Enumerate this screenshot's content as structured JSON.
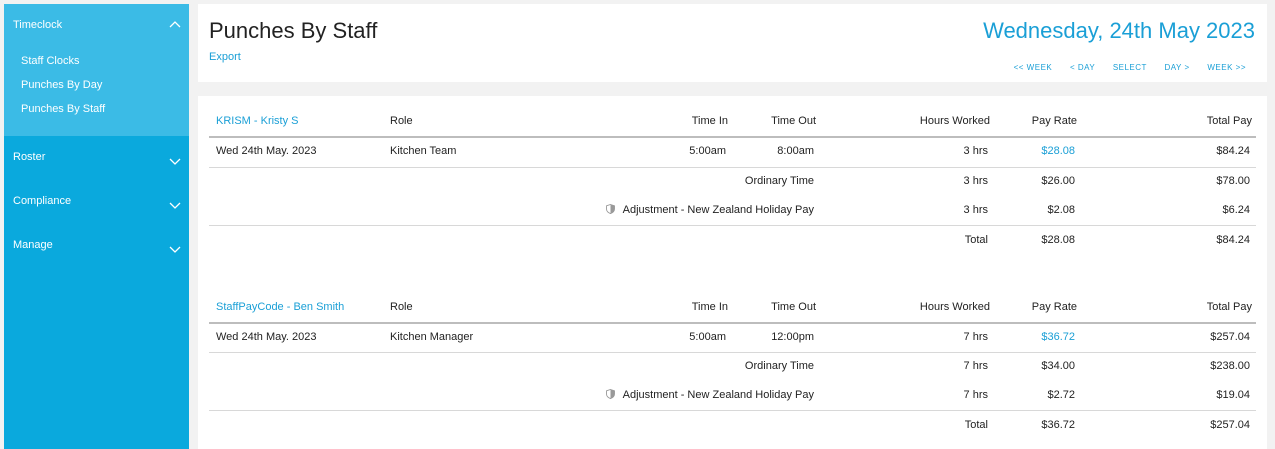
{
  "sidebar": {
    "timeclock": {
      "label": "Timeclock",
      "items": [
        "Staff Clocks",
        "Punches By Day",
        "Punches By Staff"
      ]
    },
    "sections": [
      "Roster",
      "Compliance",
      "Manage"
    ]
  },
  "header": {
    "title": "Punches By Staff",
    "export_label": "Export",
    "date": "Wednesday, 24th May 2023",
    "nav": {
      "prev_week": "<< WEEK",
      "prev_day": "< DAY",
      "select": "SELECT",
      "next_day": "DAY >",
      "next_week": "WEEK >>"
    }
  },
  "columns": {
    "role": "Role",
    "time_in": "Time In",
    "time_out": "Time Out",
    "hours": "Hours Worked",
    "pay_rate": "Pay Rate",
    "total_pay": "Total Pay"
  },
  "groups": [
    {
      "staff": "KRISM - Kristy S",
      "punch": {
        "date": "Wed 24th May. 2023",
        "role": "Kitchen Team",
        "time_in": "5:00am",
        "time_out": "8:00am",
        "hours": "3 hrs",
        "pay_rate": "$28.08",
        "total_pay": "$84.24"
      },
      "ordinary": {
        "label": "Ordinary Time",
        "hours": "3 hrs",
        "pay_rate": "$26.00",
        "total_pay": "$78.00"
      },
      "adjustment": {
        "label": "Adjustment - New Zealand Holiday Pay",
        "hours": "3 hrs",
        "pay_rate": "$2.08",
        "total_pay": "$6.24"
      },
      "total": {
        "label": "Total",
        "pay_rate": "$28.08",
        "total_pay": "$84.24"
      }
    },
    {
      "staff": "StaffPayCode - Ben Smith",
      "punch": {
        "date": "Wed 24th May. 2023",
        "role": "Kitchen Manager",
        "time_in": "5:00am",
        "time_out": "12:00pm",
        "hours": "7 hrs",
        "pay_rate": "$36.72",
        "total_pay": "$257.04"
      },
      "ordinary": {
        "label": "Ordinary Time",
        "hours": "7 hrs",
        "pay_rate": "$34.00",
        "total_pay": "$238.00"
      },
      "adjustment": {
        "label": "Adjustment - New Zealand Holiday Pay",
        "hours": "7 hrs",
        "pay_rate": "$2.72",
        "total_pay": "$19.04"
      },
      "total": {
        "label": "Total",
        "pay_rate": "$36.72",
        "total_pay": "$257.04"
      }
    }
  ],
  "icons": {
    "chevron_up": "chevron-up-icon",
    "chevron_down": "chevron-down-icon",
    "shield": "shield-icon"
  },
  "colors": {
    "sidebar": "#0aa9dd",
    "sidebar_open": "#3bbbe6",
    "accent": "#1a9fd6",
    "background": "#f2f2f2"
  }
}
